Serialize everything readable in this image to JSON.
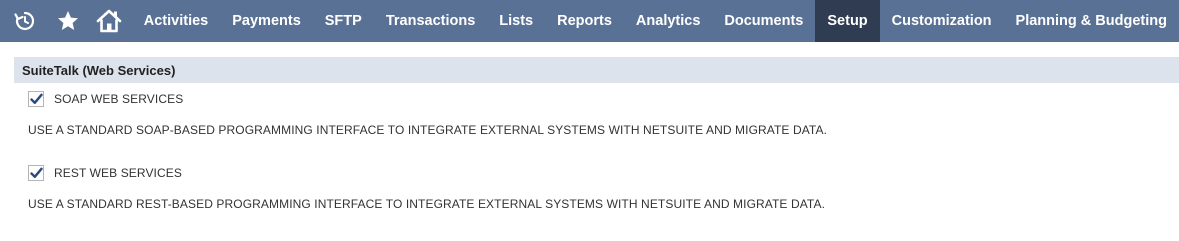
{
  "nav": {
    "icons": [
      {
        "name": "recent-history-icon"
      },
      {
        "name": "favorites-star-icon"
      },
      {
        "name": "home-icon"
      }
    ],
    "items": [
      {
        "label": "Activities",
        "active": false
      },
      {
        "label": "Payments",
        "active": false
      },
      {
        "label": "SFTP",
        "active": false
      },
      {
        "label": "Transactions",
        "active": false
      },
      {
        "label": "Lists",
        "active": false
      },
      {
        "label": "Reports",
        "active": false
      },
      {
        "label": "Analytics",
        "active": false
      },
      {
        "label": "Documents",
        "active": false
      },
      {
        "label": "Setup",
        "active": true
      },
      {
        "label": "Customization",
        "active": false
      },
      {
        "label": "Planning & Budgeting",
        "active": false
      }
    ],
    "colors": {
      "bar": "#5a7196",
      "active": "#2f3c52",
      "text": "#ffffff"
    }
  },
  "section": {
    "title": "SuiteTalk (Web Services)"
  },
  "fields": [
    {
      "label": "SOAP WEB SERVICES",
      "checked": true,
      "help": "USE A STANDARD SOAP-BASED PROGRAMMING INTERFACE TO INTEGRATE EXTERNAL SYSTEMS WITH NETSUITE AND MIGRATE DATA."
    },
    {
      "label": "REST WEB SERVICES",
      "checked": true,
      "help": "USE A STANDARD REST-BASED PROGRAMMING INTERFACE TO INTEGRATE EXTERNAL SYSTEMS WITH NETSUITE AND MIGRATE DATA."
    }
  ]
}
